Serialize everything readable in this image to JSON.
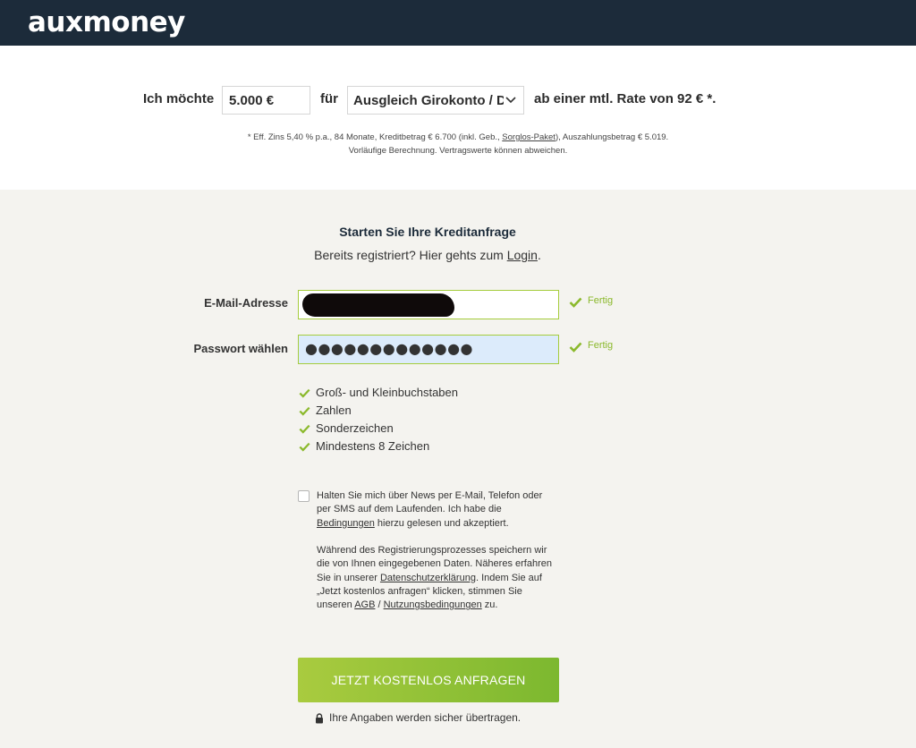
{
  "brand": {
    "logo": "auxmoney"
  },
  "calculator": {
    "prefix": "Ich möchte",
    "amount_value": "5.000 €",
    "connector": "für",
    "purpose_value": "Ausgleich Girokonto / Dispo",
    "suffix": "ab einer mtl. Rate von 92 € *.",
    "footnote_before_link": "* Eff. Zins 5,40 % p.a., 84 Monate, Kreditbetrag € 6.700 (inkl. Geb., ",
    "footnote_link": "Sorglos-Paket",
    "footnote_after_link": "), Auszahlungsbetrag € 5.019.",
    "footnote_line2": "Vorläufige Berechnung. Vertragswerte können abweichen."
  },
  "form": {
    "title": "Starten Sie Ihre Kreditanfrage",
    "login_prompt": "Bereits registriert? Hier gehts zum",
    "login_link": "Login",
    "login_end": ".",
    "email_label": "E-Mail-Adresse",
    "email_status": "Fertig",
    "password_label": "Passwort wählen",
    "password_value": "●●●●●●●●●●●●●",
    "password_status": "Fertig",
    "rules": [
      "Groß- und Kleinbuchstaben",
      "Zahlen",
      "Sonderzeichen",
      "Mindestens 8 Zeichen"
    ],
    "newsletter_checked": false,
    "consent1_a": "Halten Sie mich über News per E-Mail, Telefon oder per SMS auf dem Laufenden. Ich habe die ",
    "consent1_link": "Bedingungen",
    "consent1_b": " hierzu gelesen und akzeptiert.",
    "consent2_a": "Während des Registrierungsprozesses speichern wir die von Ihnen eingegebenen Daten. Näheres erfahren Sie in unserer ",
    "consent2_link1": "Datenschutzerklärung",
    "consent2_b": ". Indem Sie auf „Jetzt kostenlos anfragen“ klicken, stimmen Sie unseren ",
    "consent2_link2": "AGB",
    "consent2_c": " / ",
    "consent2_link3": "Nutzungsbedingungen",
    "consent2_d": " zu.",
    "submit_label": "Jetzt kostenlos anfragen",
    "secure_note": "Ihre Angaben werden sicher übertragen."
  },
  "colors": {
    "header_bg": "#1c2b3a",
    "accent_green": "#8bb92c",
    "page_bg": "#f4f3ef",
    "password_field_bg": "#dcebfb"
  },
  "icons": [
    "check-icon",
    "chevron-down-icon",
    "lock-icon"
  ]
}
